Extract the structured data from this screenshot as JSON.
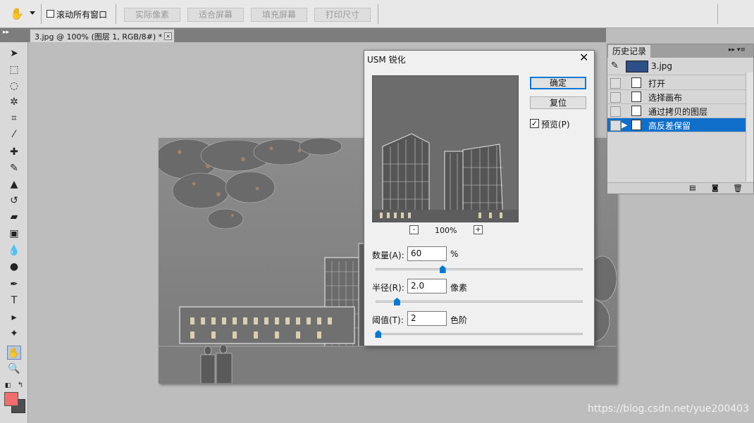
{
  "options_bar": {
    "scroll_all_label": "滚动所有窗口",
    "buttons": [
      "实际像素",
      "适合屏幕",
      "填充屏幕",
      "打印尺寸"
    ]
  },
  "document_tab": {
    "title": "3.jpg @ 100% (图层 1, RGB/8#) *",
    "close_glyph": "×"
  },
  "tools": {
    "icons": [
      "move-icon",
      "marquee-icon",
      "lasso-icon",
      "quick-select-icon",
      "crop-icon",
      "eyedropper-icon",
      "healing-brush-icon",
      "brush-icon",
      "clone-stamp-icon",
      "history-brush-icon",
      "eraser-icon",
      "gradient-icon",
      "blur-icon",
      "dodge-icon",
      "pen-icon",
      "type-icon",
      "path-select-icon",
      "shape-icon",
      "hand-icon",
      "zoom-icon"
    ],
    "type_tool_label": "T",
    "foreground_color": "#f36d6d",
    "background_color": "#4e4e4e"
  },
  "history_panel": {
    "tab_label": "历史记录",
    "snapshot_label": "3.jpg",
    "items": [
      {
        "label": "打开",
        "selected": false
      },
      {
        "label": "选择画布",
        "selected": false
      },
      {
        "label": "通过拷贝的图层",
        "selected": false
      },
      {
        "label": "高反差保留",
        "selected": true
      }
    ]
  },
  "dialog": {
    "title": "USM 锐化",
    "ok_label": "确定",
    "reset_label": "复位",
    "preview_label": "预览(P)",
    "preview_checked": true,
    "zoom_minus": "-",
    "zoom_level": "100%",
    "zoom_plus": "+",
    "params": [
      {
        "label": "数量(A):",
        "value": "60",
        "unit": "%",
        "slider_fraction": 0.32
      },
      {
        "label": "半径(R):",
        "value": "2.0",
        "unit": "像素",
        "slider_fraction": 0.1
      },
      {
        "label": "阈值(T):",
        "value": "2",
        "unit": "色阶",
        "slider_fraction": 0.01
      }
    ]
  },
  "watermark": "https://blog.csdn.net/yue200403"
}
